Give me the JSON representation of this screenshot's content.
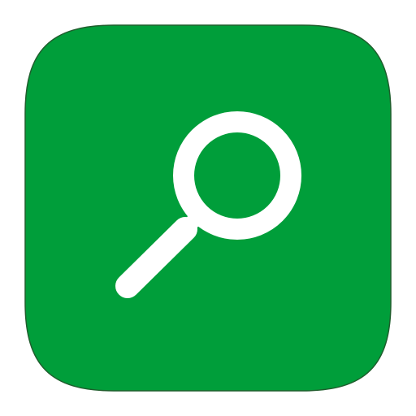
{
  "app_icon": {
    "icon": "search-icon",
    "background_color": "#009e3a",
    "glyph_color": "#ffffff",
    "border_color": "#1f5e2d"
  }
}
